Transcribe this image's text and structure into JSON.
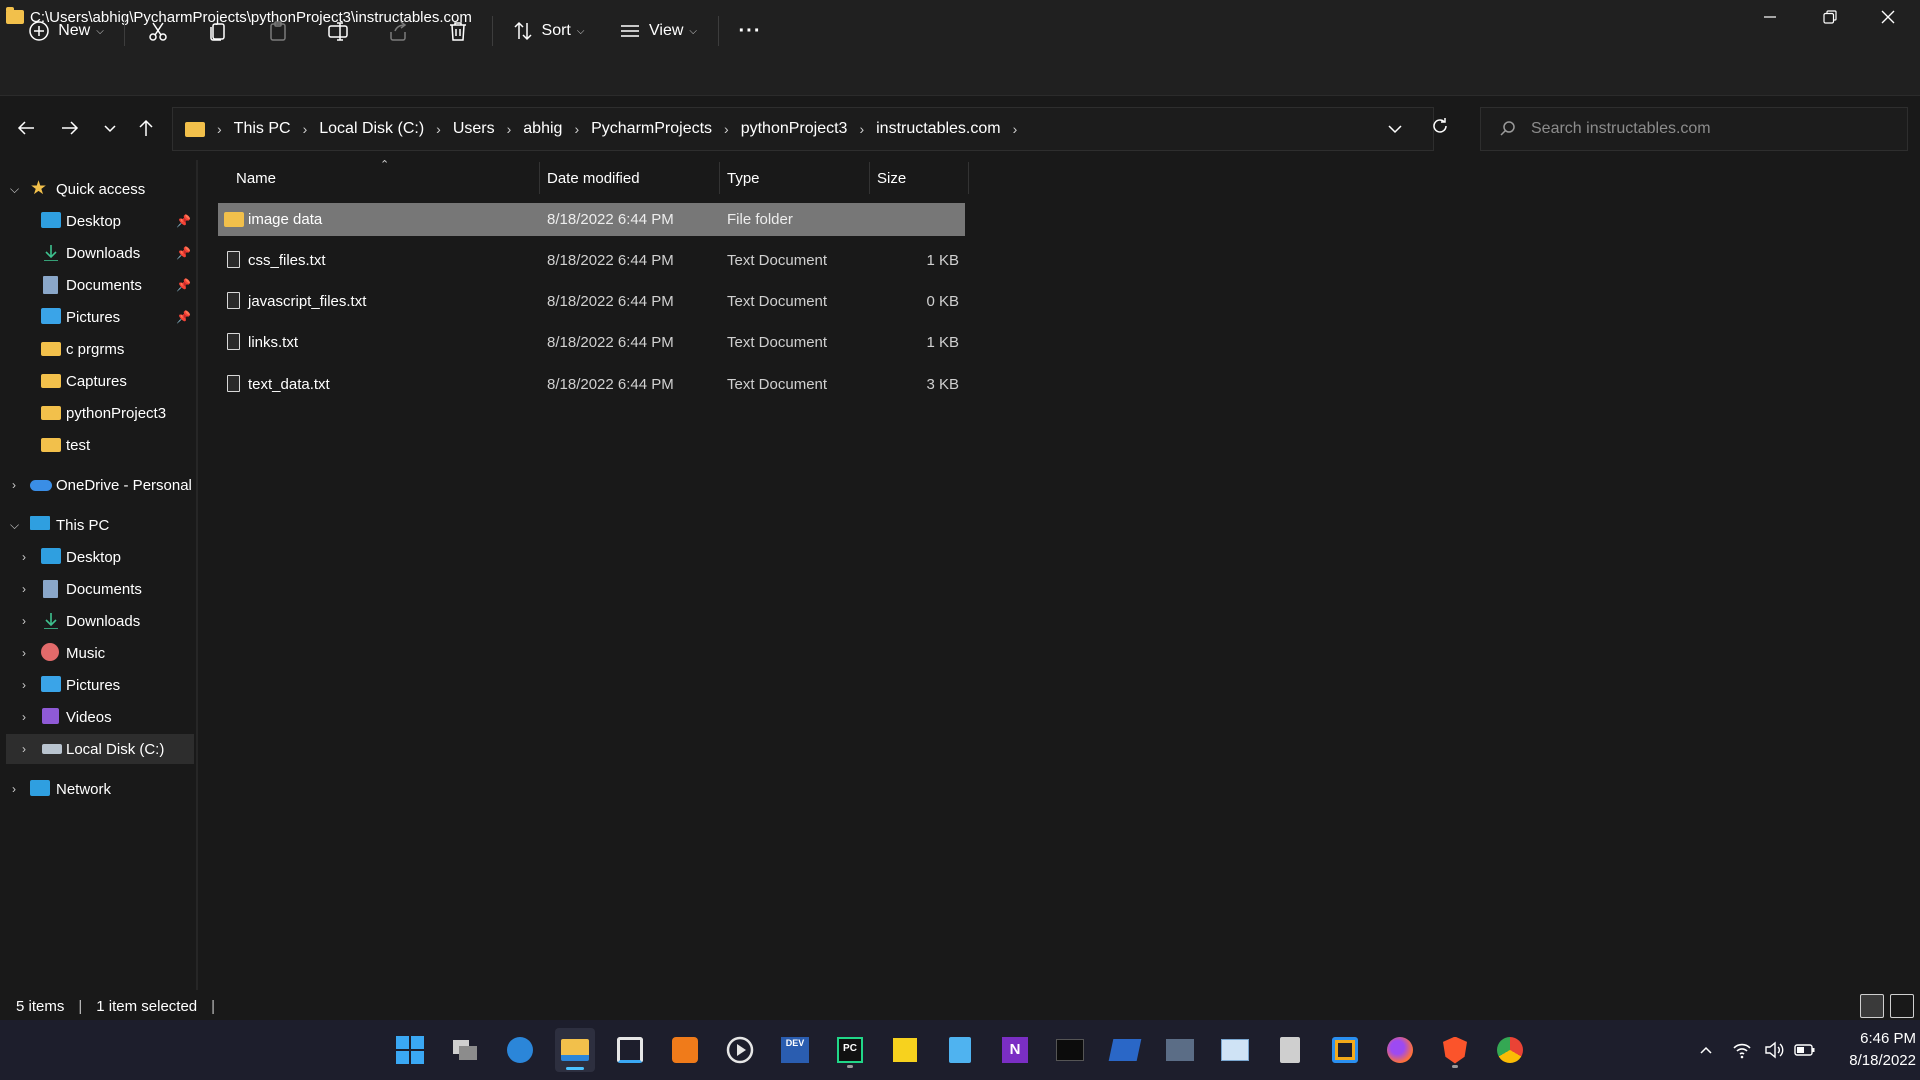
{
  "window": {
    "title": "C:\\Users\\abhig\\PycharmProjects\\pythonProject3\\instructables.com"
  },
  "toolbar": {
    "new_label": "New",
    "sort_label": "Sort",
    "view_label": "View",
    "more_label": "···"
  },
  "address": {
    "crumbs": [
      "This PC",
      "Local Disk (C:)",
      "Users",
      "abhig",
      "PycharmProjects",
      "pythonProject3",
      "instructables.com"
    ]
  },
  "search": {
    "placeholder": "Search instructables.com"
  },
  "sidebar": {
    "quick_access": "Quick access",
    "quick_items": [
      "Desktop",
      "Downloads",
      "Documents",
      "Pictures",
      "c prgrms",
      "Captures",
      "pythonProject3",
      "test"
    ],
    "onedrive": "OneDrive - Personal",
    "this_pc": "This PC",
    "pc_items": [
      "Desktop",
      "Documents",
      "Downloads",
      "Music",
      "Pictures",
      "Videos",
      "Local Disk (C:)"
    ],
    "network": "Network"
  },
  "columns": {
    "name": "Name",
    "date": "Date modified",
    "type": "Type",
    "size": "Size"
  },
  "files": [
    {
      "name": "image data",
      "date": "8/18/2022 6:44 PM",
      "type": "File folder",
      "size": "",
      "kind": "folder",
      "selected": true
    },
    {
      "name": "css_files.txt",
      "date": "8/18/2022 6:44 PM",
      "type": "Text Document",
      "size": "1 KB",
      "kind": "doc",
      "selected": false
    },
    {
      "name": "javascript_files.txt",
      "date": "8/18/2022 6:44 PM",
      "type": "Text Document",
      "size": "0 KB",
      "kind": "doc",
      "selected": false
    },
    {
      "name": "links.txt",
      "date": "8/18/2022 6:44 PM",
      "type": "Text Document",
      "size": "1 KB",
      "kind": "doc",
      "selected": false
    },
    {
      "name": "text_data.txt",
      "date": "8/18/2022 6:44 PM",
      "type": "Text Document",
      "size": "3 KB",
      "kind": "doc",
      "selected": false
    }
  ],
  "status": {
    "items": "5 items",
    "selected": "1 item selected"
  },
  "clock": {
    "time": "6:46 PM",
    "date": "8/18/2022"
  },
  "colors": {
    "folder": "#f2c04b",
    "selected_row": "#777777",
    "accent": "#4cc2ff",
    "taskbar": "#1d1e2c"
  }
}
